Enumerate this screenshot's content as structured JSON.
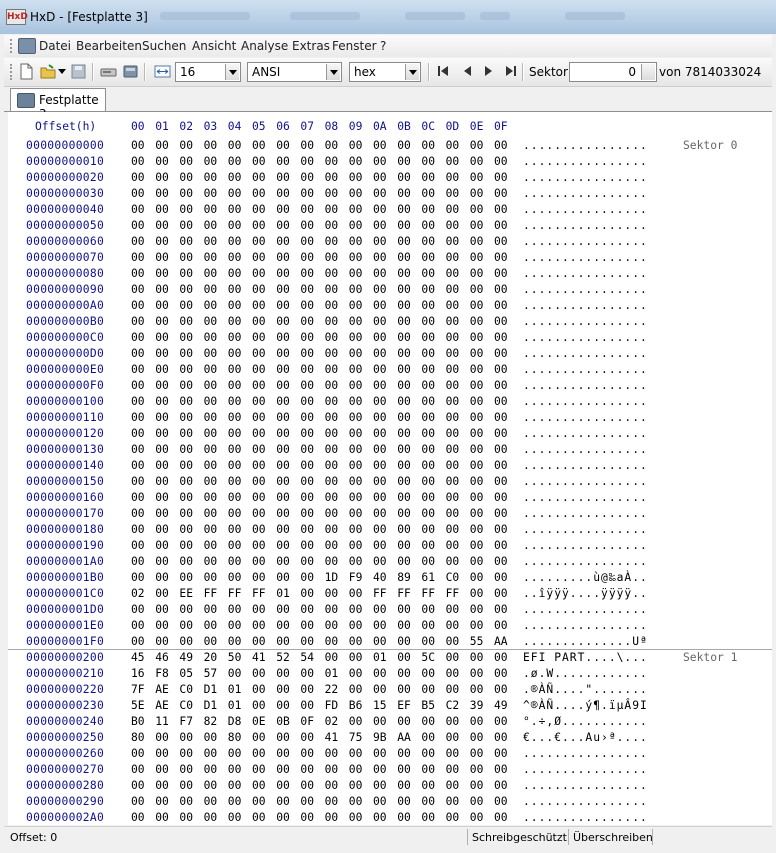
{
  "window": {
    "title": "HxD - [Festplatte 3]",
    "app_icon": "hxd-icon"
  },
  "menu": {
    "items": [
      "Datei",
      "Bearbeiten",
      "Suchen",
      "Ansicht",
      "Analyse",
      "Extras",
      "Fenster",
      "?"
    ]
  },
  "toolbar": {
    "bytes_per_row": "16",
    "charset": "ANSI",
    "offset_base": "hex",
    "sector_label": "Sektor",
    "sector_value": "0",
    "sector_total": "von 7814033024",
    "icons": [
      "new-file-icon",
      "open-folder-icon",
      "save-icon",
      "open-disk-icon",
      "open-ram-icon",
      "row-width-icon",
      "first-sector-icon",
      "previous-sector-icon",
      "next-sector-icon",
      "last-sector-icon"
    ]
  },
  "tab": {
    "label": "Festplatte 3"
  },
  "editor": {
    "offset_header": "Offset(h)",
    "column_headers": [
      "00",
      "01",
      "02",
      "03",
      "04",
      "05",
      "06",
      "07",
      "08",
      "09",
      "0A",
      "0B",
      "0C",
      "0D",
      "0E",
      "0F"
    ],
    "rows": [
      {
        "offset": "00000000000",
        "bytes": "00 00 00 00 00 00 00 00 00 00 00 00 00 00 00 00",
        "ascii": "................",
        "sector": "Sektor 0"
      },
      {
        "offset": "00000000010",
        "bytes": "00 00 00 00 00 00 00 00 00 00 00 00 00 00 00 00",
        "ascii": "................"
      },
      {
        "offset": "00000000020",
        "bytes": "00 00 00 00 00 00 00 00 00 00 00 00 00 00 00 00",
        "ascii": "................"
      },
      {
        "offset": "00000000030",
        "bytes": "00 00 00 00 00 00 00 00 00 00 00 00 00 00 00 00",
        "ascii": "................"
      },
      {
        "offset": "00000000040",
        "bytes": "00 00 00 00 00 00 00 00 00 00 00 00 00 00 00 00",
        "ascii": "................"
      },
      {
        "offset": "00000000050",
        "bytes": "00 00 00 00 00 00 00 00 00 00 00 00 00 00 00 00",
        "ascii": "................"
      },
      {
        "offset": "00000000060",
        "bytes": "00 00 00 00 00 00 00 00 00 00 00 00 00 00 00 00",
        "ascii": "................"
      },
      {
        "offset": "00000000070",
        "bytes": "00 00 00 00 00 00 00 00 00 00 00 00 00 00 00 00",
        "ascii": "................"
      },
      {
        "offset": "00000000080",
        "bytes": "00 00 00 00 00 00 00 00 00 00 00 00 00 00 00 00",
        "ascii": "................"
      },
      {
        "offset": "00000000090",
        "bytes": "00 00 00 00 00 00 00 00 00 00 00 00 00 00 00 00",
        "ascii": "................"
      },
      {
        "offset": "000000000A0",
        "bytes": "00 00 00 00 00 00 00 00 00 00 00 00 00 00 00 00",
        "ascii": "................"
      },
      {
        "offset": "000000000B0",
        "bytes": "00 00 00 00 00 00 00 00 00 00 00 00 00 00 00 00",
        "ascii": "................"
      },
      {
        "offset": "000000000C0",
        "bytes": "00 00 00 00 00 00 00 00 00 00 00 00 00 00 00 00",
        "ascii": "................"
      },
      {
        "offset": "000000000D0",
        "bytes": "00 00 00 00 00 00 00 00 00 00 00 00 00 00 00 00",
        "ascii": "................"
      },
      {
        "offset": "000000000E0",
        "bytes": "00 00 00 00 00 00 00 00 00 00 00 00 00 00 00 00",
        "ascii": "................"
      },
      {
        "offset": "000000000F0",
        "bytes": "00 00 00 00 00 00 00 00 00 00 00 00 00 00 00 00",
        "ascii": "................"
      },
      {
        "offset": "00000000100",
        "bytes": "00 00 00 00 00 00 00 00 00 00 00 00 00 00 00 00",
        "ascii": "................"
      },
      {
        "offset": "00000000110",
        "bytes": "00 00 00 00 00 00 00 00 00 00 00 00 00 00 00 00",
        "ascii": "................"
      },
      {
        "offset": "00000000120",
        "bytes": "00 00 00 00 00 00 00 00 00 00 00 00 00 00 00 00",
        "ascii": "................"
      },
      {
        "offset": "00000000130",
        "bytes": "00 00 00 00 00 00 00 00 00 00 00 00 00 00 00 00",
        "ascii": "................"
      },
      {
        "offset": "00000000140",
        "bytes": "00 00 00 00 00 00 00 00 00 00 00 00 00 00 00 00",
        "ascii": "................"
      },
      {
        "offset": "00000000150",
        "bytes": "00 00 00 00 00 00 00 00 00 00 00 00 00 00 00 00",
        "ascii": "................"
      },
      {
        "offset": "00000000160",
        "bytes": "00 00 00 00 00 00 00 00 00 00 00 00 00 00 00 00",
        "ascii": "................"
      },
      {
        "offset": "00000000170",
        "bytes": "00 00 00 00 00 00 00 00 00 00 00 00 00 00 00 00",
        "ascii": "................"
      },
      {
        "offset": "00000000180",
        "bytes": "00 00 00 00 00 00 00 00 00 00 00 00 00 00 00 00",
        "ascii": "................"
      },
      {
        "offset": "00000000190",
        "bytes": "00 00 00 00 00 00 00 00 00 00 00 00 00 00 00 00",
        "ascii": "................"
      },
      {
        "offset": "000000001A0",
        "bytes": "00 00 00 00 00 00 00 00 00 00 00 00 00 00 00 00",
        "ascii": "................"
      },
      {
        "offset": "000000001B0",
        "bytes": "00 00 00 00 00 00 00 00 1D F9 40 89 61 C0 00 00",
        "ascii": ".........ù@‰aÀ.."
      },
      {
        "offset": "000000001C0",
        "bytes": "02 00 EE FF FF FF 01 00 00 00 FF FF FF FF 00 00",
        "ascii": "..îÿÿÿ....ÿÿÿÿ.."
      },
      {
        "offset": "000000001D0",
        "bytes": "00 00 00 00 00 00 00 00 00 00 00 00 00 00 00 00",
        "ascii": "................"
      },
      {
        "offset": "000000001E0",
        "bytes": "00 00 00 00 00 00 00 00 00 00 00 00 00 00 00 00",
        "ascii": "................"
      },
      {
        "offset": "000000001F0",
        "bytes": "00 00 00 00 00 00 00 00 00 00 00 00 00 00 55 AA",
        "ascii": "..............Uª"
      },
      {
        "offset": "00000000200",
        "bytes": "45 46 49 20 50 41 52 54 00 00 01 00 5C 00 00 00",
        "ascii": "EFI PART....\\...",
        "sector": "Sektor 1"
      },
      {
        "offset": "00000000210",
        "bytes": "16 F8 05 57 00 00 00 00 01 00 00 00 00 00 00 00",
        "ascii": ".ø.W............"
      },
      {
        "offset": "00000000220",
        "bytes": "7F AE C0 D1 01 00 00 00 22 00 00 00 00 00 00 00",
        "ascii": ".®ÀÑ....\"......."
      },
      {
        "offset": "00000000230",
        "bytes": "5E AE C0 D1 01 00 00 00 FD B6 15 EF B5 C2 39 49",
        "ascii": "^®ÀÑ....ý¶.ïµÂ9I"
      },
      {
        "offset": "00000000240",
        "bytes": "B0 11 F7 82 D8 0E 0B 0F 02 00 00 00 00 00 00 00",
        "ascii": "°.÷‚Ø..........."
      },
      {
        "offset": "00000000250",
        "bytes": "80 00 00 00 80 00 00 00 41 75 9B AA 00 00 00 00",
        "ascii": "€...€...Au›ª...."
      },
      {
        "offset": "00000000260",
        "bytes": "00 00 00 00 00 00 00 00 00 00 00 00 00 00 00 00",
        "ascii": "................"
      },
      {
        "offset": "00000000270",
        "bytes": "00 00 00 00 00 00 00 00 00 00 00 00 00 00 00 00",
        "ascii": "................"
      },
      {
        "offset": "00000000280",
        "bytes": "00 00 00 00 00 00 00 00 00 00 00 00 00 00 00 00",
        "ascii": "................"
      },
      {
        "offset": "00000000290",
        "bytes": "00 00 00 00 00 00 00 00 00 00 00 00 00 00 00 00",
        "ascii": "................"
      },
      {
        "offset": "000000002A0",
        "bytes": "00 00 00 00 00 00 00 00 00 00 00 00 00 00 00 00",
        "ascii": "................"
      }
    ]
  },
  "status": {
    "offset": "Offset: 0",
    "write_protect": "Schreibgeschützt",
    "mode": "Überschreiben"
  }
}
